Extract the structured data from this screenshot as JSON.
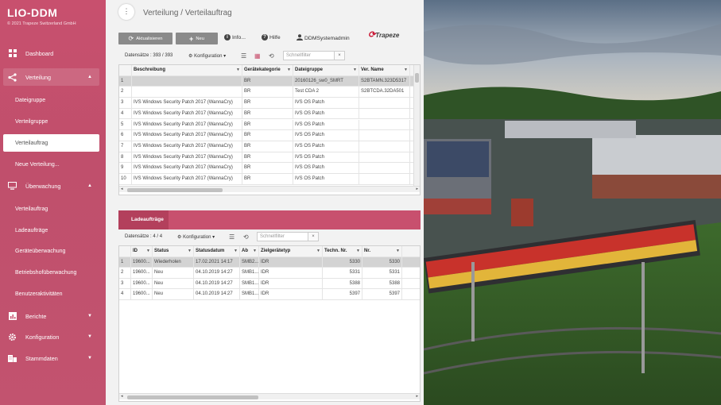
{
  "app": {
    "logo_prefix": "LIO",
    "logo_suffix": "-DDM",
    "copyright": "© 2021 Trapeze Switzerland GmbH"
  },
  "sidebar": {
    "dashboard": "Dashboard",
    "verteilung": "Verteilung",
    "verteilung_sub": [
      "Dateigruppe",
      "Verteilgruppe",
      "Verteilauftrag",
      "Neue Verteilung..."
    ],
    "ueberwachung": "Überwachung",
    "ueberwachung_sub": [
      "Verteilauftrag",
      "Ladeaufträge",
      "Geräteüberwachung",
      "Betriebshofüberwachung",
      "Benutzeraktivitäten"
    ],
    "berichte": "Berichte",
    "konfiguration": "Konfiguration",
    "stammdaten": "Stammdaten",
    "chevron_down": "▼",
    "chevron_up": "▲"
  },
  "header": {
    "more_icon": "⋮",
    "breadcrumb": "Verteilung / Verteilauftrag"
  },
  "toolbar": {
    "refresh_label": "Aktualisieren",
    "new_label": "Neu",
    "info_label": "Info...",
    "help_label": "Hilfe",
    "user_label": "DDMSystemadmin",
    "brand": "Trapeze"
  },
  "top_filter": {
    "count": "Datensätze : 393 / 393",
    "konfig": "Konfiguration",
    "placeholder": "Schnellfilter",
    "clear": "×"
  },
  "top_grid": {
    "columns": [
      "",
      "Beschreibung",
      "Gerätekategorie",
      "Dateigruppe",
      "Ver. Name"
    ],
    "rows": [
      [
        "1",
        "",
        "BR",
        "20160126_sw0_SMRT",
        "S2BTAMN.323D5317"
      ],
      [
        "2",
        "",
        "BR",
        "Test CDA 2",
        "S2BTCDA.32DA501"
      ],
      [
        "3",
        "IVS Windows Security Patch 2017 (WannaCry)",
        "BR",
        "IVS OS Patch",
        ""
      ],
      [
        "4",
        "IVS Windows Security Patch 2017 (WannaCry)",
        "BR",
        "IVS OS Patch",
        ""
      ],
      [
        "5",
        "IVS Windows Security Patch 2017 (WannaCry)",
        "BR",
        "IVS OS Patch",
        ""
      ],
      [
        "6",
        "IVS Windows Security Patch 2017 (WannaCry)",
        "BR",
        "IVS OS Patch",
        ""
      ],
      [
        "7",
        "IVS Windows Security Patch 2017 (WannaCry)",
        "BR",
        "IVS OS Patch",
        ""
      ],
      [
        "8",
        "IVS Windows Security Patch 2017 (WannaCry)",
        "BR",
        "IVS OS Patch",
        ""
      ],
      [
        "9",
        "IVS Windows Security Patch 2017 (WannaCry)",
        "BR",
        "IVS OS Patch",
        ""
      ],
      [
        "10",
        "IVS Windows Security Patch 2017 (WannaCry)",
        "BR",
        "IVS OS Patch",
        ""
      ]
    ]
  },
  "section": {
    "tab": "Ladeaufträge"
  },
  "bottom_filter": {
    "count": "Datensätze : 4 / 4",
    "konfig": "Konfiguration",
    "placeholder": "Schnellfilter",
    "clear": "×"
  },
  "bottom_grid": {
    "columns": [
      "",
      "ID",
      "Status",
      "Statusdatum",
      "Ab",
      "Zielgerätetyp",
      "Techn. Nr.",
      "Nr."
    ],
    "rows": [
      [
        "1",
        "19600...",
        "Wiederholen",
        "17.02.2021 14:17",
        "SMB2...",
        "IDR",
        "5330",
        "5330"
      ],
      [
        "2",
        "19600...",
        "Neu",
        "04.10.2019 14:27",
        "SMB1...",
        "IDR",
        "5331",
        "5331"
      ],
      [
        "3",
        "19600...",
        "Neu",
        "04.10.2019 14:27",
        "SMB1...",
        "IDR",
        "5388",
        "5388"
      ],
      [
        "4",
        "19600...",
        "Neu",
        "04.10.2019 14:27",
        "SMB1...",
        "IDR",
        "5397",
        "5397"
      ]
    ]
  },
  "colors": {
    "accent": "#c8506e",
    "accent_dark": "#b3405c"
  }
}
